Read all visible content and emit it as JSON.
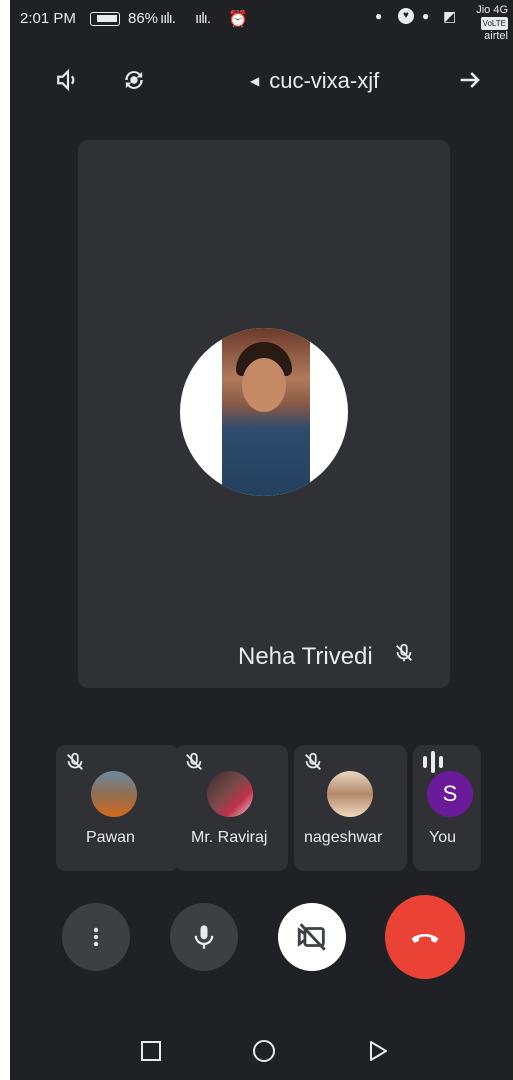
{
  "status_bar": {
    "time": "2:01 PM",
    "battery": "86%",
    "signal_1": "ıılı.",
    "signal_2": "ıılı.",
    "alarm_icon": "alarm-icon",
    "carrier_top": "Jio 4G",
    "volte": "VoLTE",
    "carrier_bottom": "airtel"
  },
  "top_bar": {
    "meeting_code": "cuc-vixa-xjf",
    "icons": [
      "speaker-icon",
      "flip-camera-icon",
      "arrow-back-icon"
    ]
  },
  "main_tile": {
    "participant_name": "Neha Trivedi",
    "mic_state": "muted"
  },
  "participants": [
    {
      "name": "Pawan",
      "mic_state": "muted"
    },
    {
      "name": "Mr. Raviraj",
      "mic_state": "muted"
    },
    {
      "name": "nageshwar",
      "mic_state": "muted"
    },
    {
      "name": "You",
      "initial": "S",
      "mic_state": "speaking"
    }
  ],
  "controls": {
    "icons": [
      "more-options-icon",
      "mic-icon",
      "camera-off-icon",
      "end-call-icon"
    ],
    "end_call_color": "#ea4335"
  },
  "nav_bar": {
    "icons": [
      "recent-apps-icon",
      "home-icon",
      "back-icon"
    ]
  },
  "colors": {
    "background": "#202124",
    "tile": "#303134",
    "control": "#3c4043",
    "avatar_you": "#6a1b9a"
  }
}
